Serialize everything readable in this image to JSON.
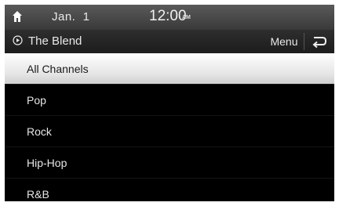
{
  "status_bar": {
    "home_icon": "home-icon",
    "date": "Jan.  1",
    "time": "12:00",
    "ampm": "AM"
  },
  "title_bar": {
    "play_icon": "play-circle-icon",
    "title": "The Blend",
    "menu_label": "Menu",
    "back_icon": "back-arrow-icon"
  },
  "channel_list": {
    "selected_index": 0,
    "items": [
      {
        "label": "All Channels"
      },
      {
        "label": "Pop"
      },
      {
        "label": "Rock"
      },
      {
        "label": "Hip-Hop"
      },
      {
        "label": "R&B"
      }
    ]
  },
  "colors": {
    "background": "#000000",
    "selected_highlight": "#f0f0f0",
    "text": "#e6e6e6"
  }
}
